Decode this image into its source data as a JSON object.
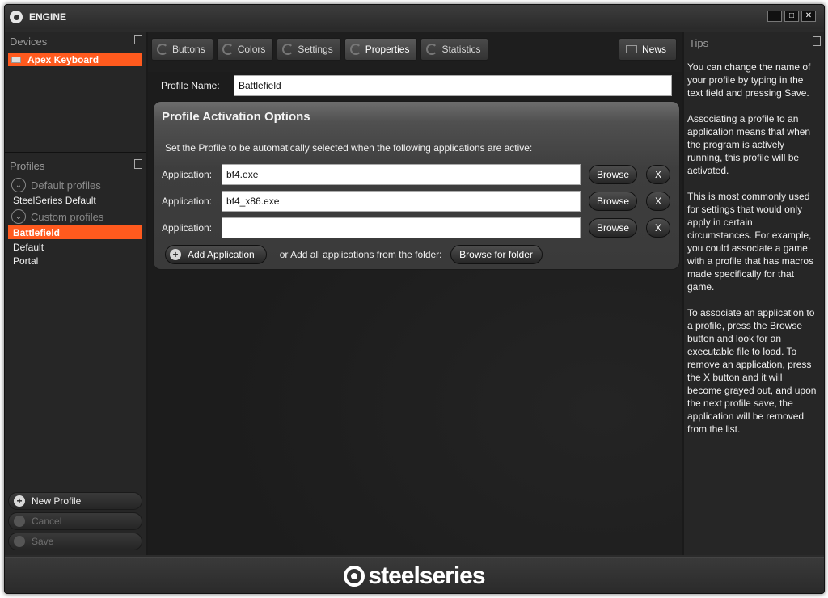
{
  "window": {
    "title": "ENGINE",
    "minimize": "_",
    "maximize": "□",
    "close": "✕"
  },
  "devices": {
    "header": "Devices",
    "items": [
      {
        "label": "Apex Keyboard"
      }
    ]
  },
  "profiles": {
    "header": "Profiles",
    "default_group": "Default profiles",
    "default_items": [
      "SteelSeries Default"
    ],
    "custom_group": "Custom profiles",
    "custom_items": [
      "Battlefield",
      "Default",
      "Portal"
    ],
    "selected": "Battlefield",
    "new_label": "New Profile",
    "cancel_label": "Cancel",
    "save_label": "Save"
  },
  "tabs": [
    "Buttons",
    "Colors",
    "Settings",
    "Properties",
    "Statistics"
  ],
  "active_tab": "Properties",
  "news_label": "News",
  "profile_name": {
    "label": "Profile Name:",
    "value": "Battlefield"
  },
  "activation": {
    "title": "Profile Activation Options",
    "description": "Set the Profile to be automatically selected when the following applications are active:",
    "app_label": "Application:",
    "browse_label": "Browse",
    "remove_label": "X",
    "apps": [
      "bf4.exe",
      "bf4_x86.exe",
      ""
    ],
    "add_label": "Add Application",
    "folder_text": "or Add all applications from the folder:",
    "folder_button": "Browse for folder"
  },
  "tips": {
    "header": "Tips",
    "paragraphs": [
      "You can change the name of your profile by typing in the text field and pressing Save.",
      "Associating a profile to an application means that when the program is actively running, this profile will be activated.",
      "This is most commonly used for settings that would only apply in certain circumstances. For example, you could associate a game with a profile that has macros made specifically for that game.",
      "To associate an application to a profile, press the Browse button and look for an executable file to load.  To remove an application, press the X button and it will become grayed out, and upon the next profile save, the application will be removed from the list."
    ]
  },
  "brand": "steelseries",
  "colors": {
    "accent": "#ff5a1e",
    "panel": "#262626",
    "main": "#1e1e1e"
  }
}
